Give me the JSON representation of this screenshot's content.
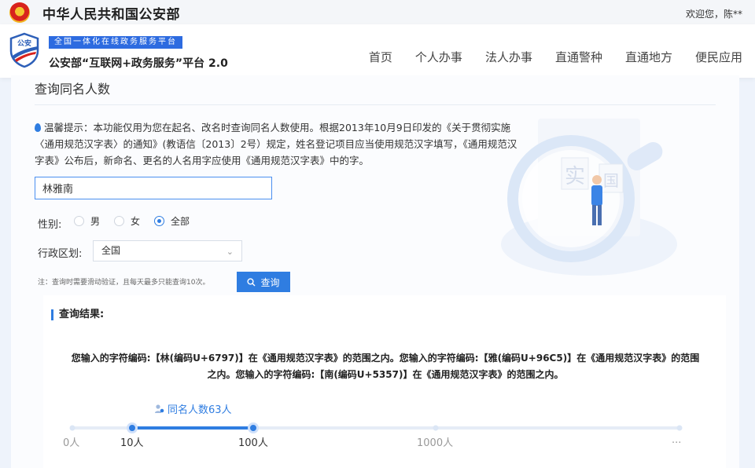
{
  "topbar": {
    "ministry": "中华人民共和国公安部",
    "welcome": "欢迎您，陈**"
  },
  "header": {
    "logo_text": "公安",
    "slogan": "全国一体化在线政务服务平台",
    "platform": "公安部“互联网+政务服务”平台 2.0"
  },
  "nav": [
    "首页",
    "个人办事",
    "法人办事",
    "直通警种",
    "直通地方",
    "便民应用"
  ],
  "page": {
    "title": "查询同名人数",
    "tip": "温馨提示：本功能仅用为您在起名、改名时查询同名人数使用。根据2013年10月9日印发的《关于贯彻实施〈通用规范汉字表〉的通知》(教语信〔2013〕2号）规定，姓名登记项目应当使用规范汉字填写，《通用规范汉字表》公布后，新命名、更名的人名用字应使用《通用规范汉字表》中的字。"
  },
  "form": {
    "name_value": "林雅南",
    "gender_label": "性别:",
    "gender_options": [
      "男",
      "女",
      "全部"
    ],
    "gender_selected": "全部",
    "region_label": "行政区划:",
    "region_value": "全国",
    "note": "注：查询时需要滑动验证，且每天最多只能查询10次。",
    "query_button": "查询"
  },
  "illustration": {
    "char1": "实",
    "char2": "国"
  },
  "result": {
    "title": "查询结果:",
    "text": "您输入的字符编码:【林(编码U+6797)】在《通用规范汉字表》的范围之内。您输入的字符编码:【雅(编码U+96C5)】在《通用规范汉字表》的范围之内。您输入的字符编码:【南(编码U+5357)】在《通用规范汉字表》的范围之内。",
    "count_label": "同名人数63人",
    "scale_ticks": [
      "0人",
      "10人",
      "100人",
      "1000人",
      "..."
    ],
    "active_range": [
      "10人",
      "100人"
    ]
  },
  "colors": {
    "accent": "#2f7de1",
    "slogan_bg": "#2d6be0",
    "emblem_red": "#d8231d",
    "emblem_gold": "#f2b321"
  }
}
